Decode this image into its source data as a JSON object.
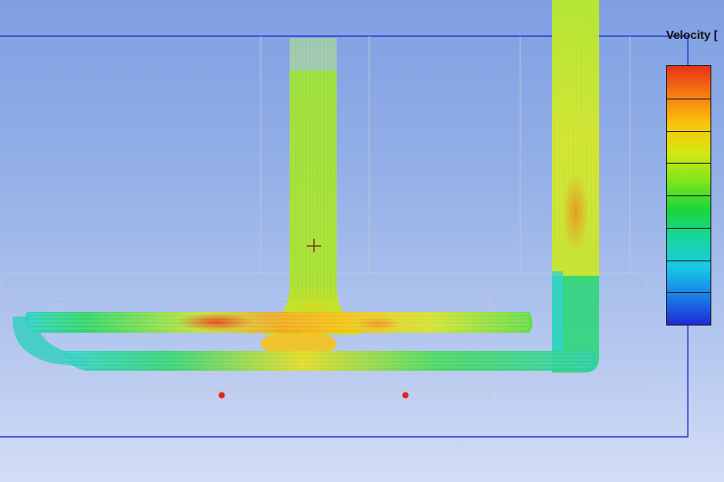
{
  "legend": {
    "title": "Velocity [",
    "colors": [
      "#e8321a",
      "#f77b12",
      "#fbc30a",
      "#d6e70f",
      "#7fe61a",
      "#19d63a",
      "#18d6a0",
      "#18c8e6",
      "#1a7fe8",
      "#1a2bd6"
    ],
    "levels": 8
  },
  "probes": {
    "left_label": "",
    "right_label": "",
    "marker_color": "#e52222"
  },
  "colors": {
    "background_top": "#7f9fe2",
    "background_bottom": "#d3ddf6",
    "domain_outline": "#2b3fd6",
    "geometry_lines": "#c8cbd8"
  }
}
